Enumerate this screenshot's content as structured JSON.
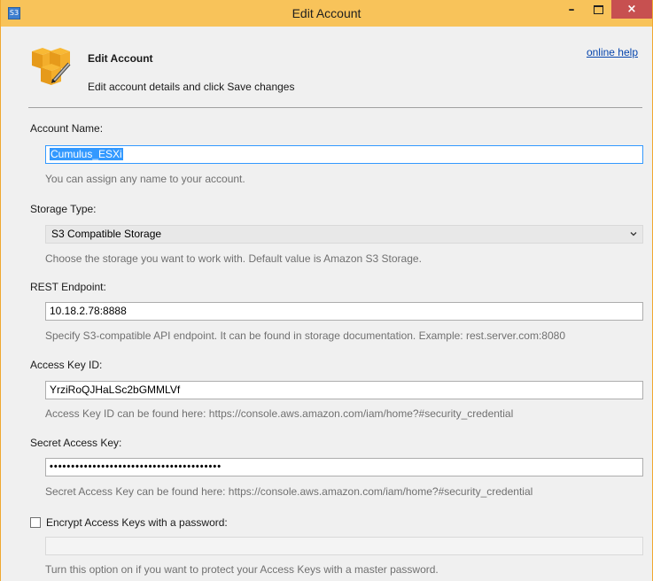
{
  "window": {
    "title": "Edit Account",
    "app_icon_text": "S3",
    "controls": {
      "minimize": "–",
      "close": "×"
    }
  },
  "header": {
    "icon": "s3-bucket-edit-icon",
    "title": "Edit Account",
    "description": "Edit account details and click Save changes",
    "help_link": "online help"
  },
  "form": {
    "account_name": {
      "label": "Account Name:",
      "value": "Cumulus_ESXi",
      "hint": "You can assign any name to your account."
    },
    "storage_type": {
      "label": "Storage Type:",
      "selected": "S3 Compatible Storage",
      "hint": "Choose the storage you want to work with. Default value is Amazon S3 Storage."
    },
    "rest_endpoint": {
      "label": "REST Endpoint:",
      "value": "10.18.2.78:8888",
      "hint": "Specify S3-compatible API endpoint. It can be found in storage documentation. Example: rest.server.com:8080"
    },
    "access_key_id": {
      "label": "Access Key ID:",
      "value": "YrziRoQJHaLSc2bGMMLVf",
      "hint": "Access Key ID can be found here: https://console.aws.amazon.com/iam/home?#security_credential"
    },
    "secret_access_key": {
      "label": "Secret Access Key:",
      "masked_value": "••••••••••••••••••••••••••••••••••••••••",
      "hint": "Secret Access Key can be found here: https://console.aws.amazon.com/iam/home?#security_credential"
    },
    "encrypt": {
      "label": "Encrypt Access Keys with a password:",
      "checked": false,
      "password_value": "",
      "hint": "Turn this option on if you want to protect your Access Keys with a master password."
    }
  },
  "colors": {
    "titlebar": "#f8c35a",
    "close_button": "#c75050",
    "selection": "#3399ff",
    "link": "#0645ad"
  }
}
